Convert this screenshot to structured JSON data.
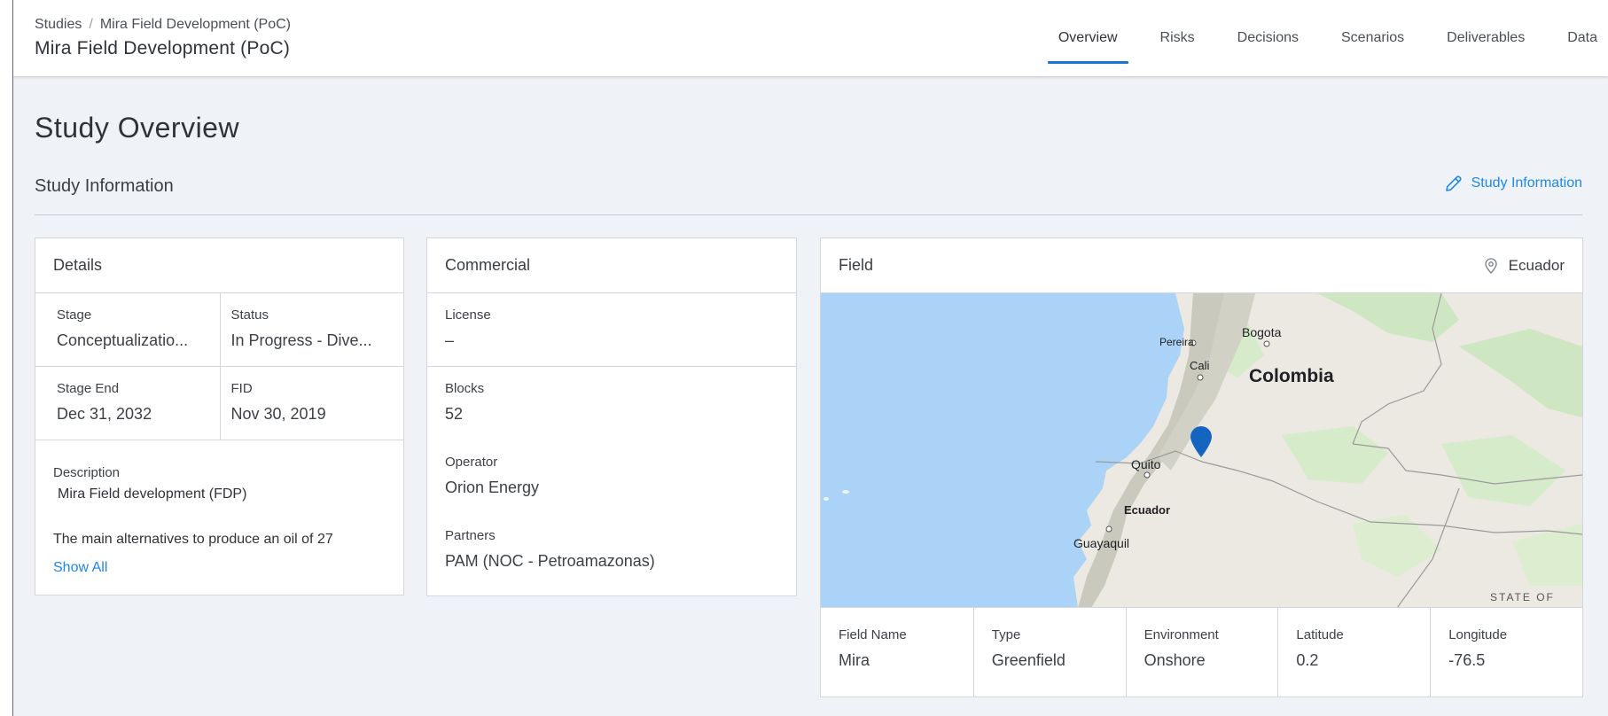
{
  "header": {
    "breadcrumb": [
      "Studies",
      "Mira Field Development (PoC)"
    ],
    "title": "Mira Field Development (PoC)",
    "tabs": [
      {
        "label": "Overview",
        "active": true
      },
      {
        "label": "Risks"
      },
      {
        "label": "Decisions"
      },
      {
        "label": "Scenarios"
      },
      {
        "label": "Deliverables"
      },
      {
        "label": "Data"
      }
    ]
  },
  "main": {
    "page_title": "Study Overview",
    "section_title": "Study Information",
    "edit_link": "Study Information",
    "accent_color": "#1e88e5"
  },
  "details": {
    "title": "Details",
    "stage_label": "Stage",
    "stage_value": "Conceptualizatio...",
    "status_label": "Status",
    "status_value": "In Progress - Dive...",
    "stage_end_label": "Stage End",
    "stage_end_value": "Dec 31, 2032",
    "fid_label": "FID",
    "fid_value": "Nov 30, 2019",
    "description_label": "Description",
    "description_line1": "Mira Field development (FDP)",
    "description_line2": "The main alternatives to produce an oil of 27",
    "show_all": "Show All"
  },
  "commercial": {
    "title": "Commercial",
    "license_label": "License",
    "license_value": "–",
    "blocks_label": "Blocks",
    "blocks_value": "52",
    "operator_label": "Operator",
    "operator_value": "Orion Energy",
    "partners_label": "Partners",
    "partners_value": "PAM (NOC - Petroamazonas)"
  },
  "field": {
    "title": "Field",
    "country": "Ecuador",
    "map_labels": {
      "colombia": "Colombia",
      "bogota": "Bogota",
      "pereira": "Pereira",
      "cali": "Cali",
      "quito": "Quito",
      "ecuador": "Ecuador",
      "guayaquil": "Guayaquil",
      "state_of": "STATE OF"
    },
    "stats": [
      {
        "label": "Field Name",
        "value": "Mira"
      },
      {
        "label": "Type",
        "value": "Greenfield"
      },
      {
        "label": "Environment",
        "value": "Onshore"
      },
      {
        "label": "Latitude",
        "value": "0.2"
      },
      {
        "label": "Longitude",
        "value": "-76.5"
      }
    ]
  }
}
